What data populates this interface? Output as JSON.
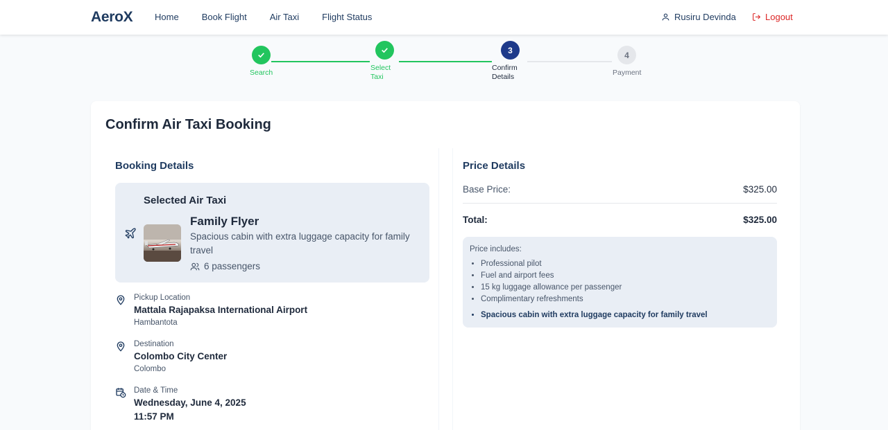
{
  "header": {
    "brand": "AeroX",
    "nav": [
      "Home",
      "Book Flight",
      "Air Taxi",
      "Flight Status"
    ],
    "user_name": "Rusiru Devinda",
    "logout_label": "Logout"
  },
  "stepper": {
    "steps": [
      {
        "number": "1",
        "label_line1": "Search",
        "label_line2": "",
        "state": "done"
      },
      {
        "number": "2",
        "label_line1": "Select",
        "label_line2": "Taxi",
        "state": "done"
      },
      {
        "number": "3",
        "label_line1": "Confirm",
        "label_line2": "Details",
        "state": "active"
      },
      {
        "number": "4",
        "label_line1": "Payment",
        "label_line2": "",
        "state": "todo"
      }
    ]
  },
  "page_title": "Confirm Air Taxi Booking",
  "booking": {
    "section_title": "Booking Details",
    "selected_title": "Selected Air Taxi",
    "taxi_name": "Family Flyer",
    "taxi_description": "Spacious cabin with extra luggage capacity for family travel",
    "passengers": "6 passengers",
    "pickup": {
      "label": "Pickup Location",
      "value": "Mattala Rajapaksa International Airport",
      "sub": "Hambantota"
    },
    "destination": {
      "label": "Destination",
      "value": "Colombo City Center",
      "sub": "Colombo"
    },
    "datetime": {
      "label": "Date & Time",
      "date": "Wednesday, June 4, 2025",
      "time": "11:57 PM"
    }
  },
  "price": {
    "section_title": "Price Details",
    "base_label": "Base Price:",
    "base_value": "$325.00",
    "total_label": "Total:",
    "total_value": "$325.00",
    "includes_title": "Price includes:",
    "includes": [
      "Professional pilot",
      "Fuel and airport fees",
      "15 kg luggage allowance per passenger",
      "Complimentary refreshments"
    ],
    "highlight": "Spacious cabin with extra luggage capacity for family travel"
  },
  "colors": {
    "brand": "#1e3a5f",
    "success": "#22c55e",
    "active_step": "#1e3a8a",
    "danger": "#dc2626"
  }
}
